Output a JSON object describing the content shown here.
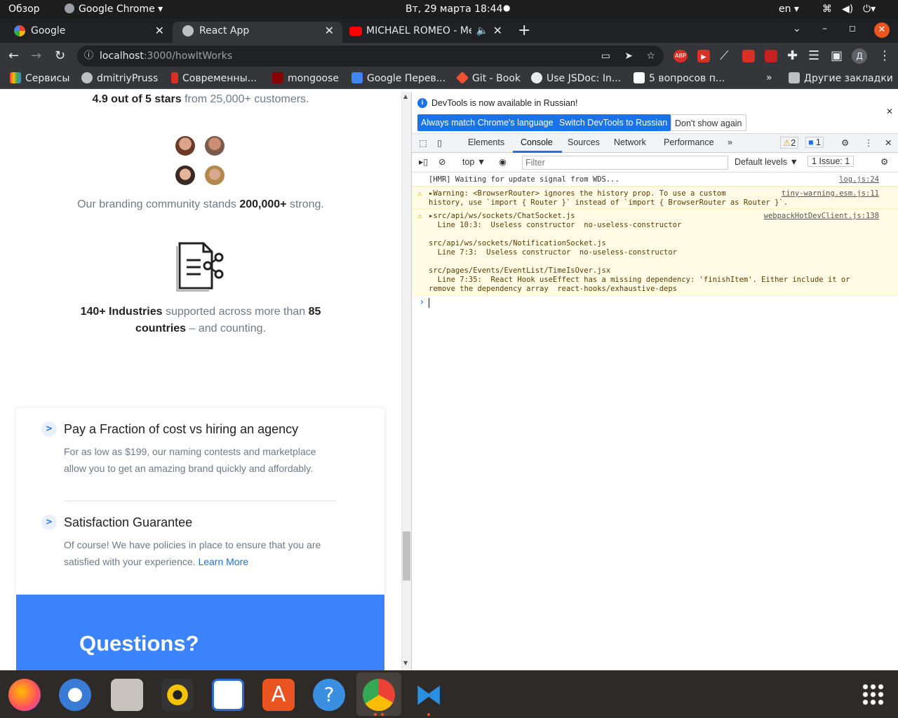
{
  "gnome": {
    "overview": "Обзор",
    "app_name": "Google Chrome ▾",
    "clock": "Вт, 29 марта  18:44",
    "lang": "en ▾"
  },
  "tabs": [
    {
      "title": "Google"
    },
    {
      "title": "React App"
    },
    {
      "title": "MICHAEL ROMEO - Me"
    }
  ],
  "omnibox": {
    "host": "localhost",
    "path": ":3000/howItWorks"
  },
  "bookmarks": [
    "Сервисы",
    "dmitriyPruss",
    "Современны...",
    "mongoose",
    "Google Перев...",
    "Git - Book",
    "Use JSDoc: In...",
    "5 вопросов п...",
    "»",
    "Другие закладки"
  ],
  "page": {
    "stars_bold": "4.9 out of 5 stars",
    "stars_rest": " from 25,000+ customers.",
    "community_pre": "Our branding community stands ",
    "community_bold": "200,000+",
    "community_post": " strong.",
    "industries_bold1": "140+ Industries",
    "industries_mid": " supported across more than ",
    "industries_bold2": "85",
    "industries_bold3": "countries",
    "industries_post": " – and counting.",
    "feature1_title": "Pay a Fraction of cost vs hiring an agency",
    "feature1_line1": "For as low as $199, our naming contests and marketplace",
    "feature1_line2": "allow you to get an amazing brand quickly and affordably.",
    "feature2_title": "Satisfaction Guarantee",
    "feature2_line1": "Of course! We have policies in place to ensure that you are",
    "feature2_line2": "satisfied with your experience. ",
    "feature2_link": "Learn More",
    "questions": "Questions?",
    "chevron": ">"
  },
  "devtools": {
    "info": "DevTools is now available in Russian!",
    "btn_match": "Always match Chrome's language",
    "btn_switch": "Switch DevTools to Russian",
    "btn_dont": "Don't show again",
    "tabs": [
      "Elements",
      "Console",
      "Sources",
      "Network",
      "Performance"
    ],
    "warn_count": "2",
    "msg_count": "1",
    "context": "top ▼",
    "filter_placeholder": "Filter",
    "levels": "Default levels ▼",
    "issues": "1 Issue:  1",
    "log1": "[HMR] Waiting for update signal from WDS...",
    "log1_src": "log.js:24",
    "warn1_a": "▸Warning: <BrowserRouter> ignores the history prop. To use a custom",
    "warn1_b": "history, use `import { Router }` instead of `import { BrowserRouter as Router }`.",
    "warn1_src": "tiny-warning.esm.js:11",
    "warn2_lines": [
      "▸src/api/ws/sockets/ChatSocket.js",
      "  Line 10:3:  Useless constructor  no-useless-constructor",
      "",
      "src/api/ws/sockets/NotificationSocket.js",
      "  Line 7:3:  Useless constructor  no-useless-constructor",
      "",
      "src/pages/Events/EventList/TimeIsOver.jsx",
      "  Line 7:35:  React Hook useEffect has a missing dependency: 'finishItem'. Either include it or",
      "remove the dependency array  react-hooks/exhaustive-deps"
    ],
    "warn2_src": "webpackHotDevClient.js:138",
    "prompt": "›"
  }
}
